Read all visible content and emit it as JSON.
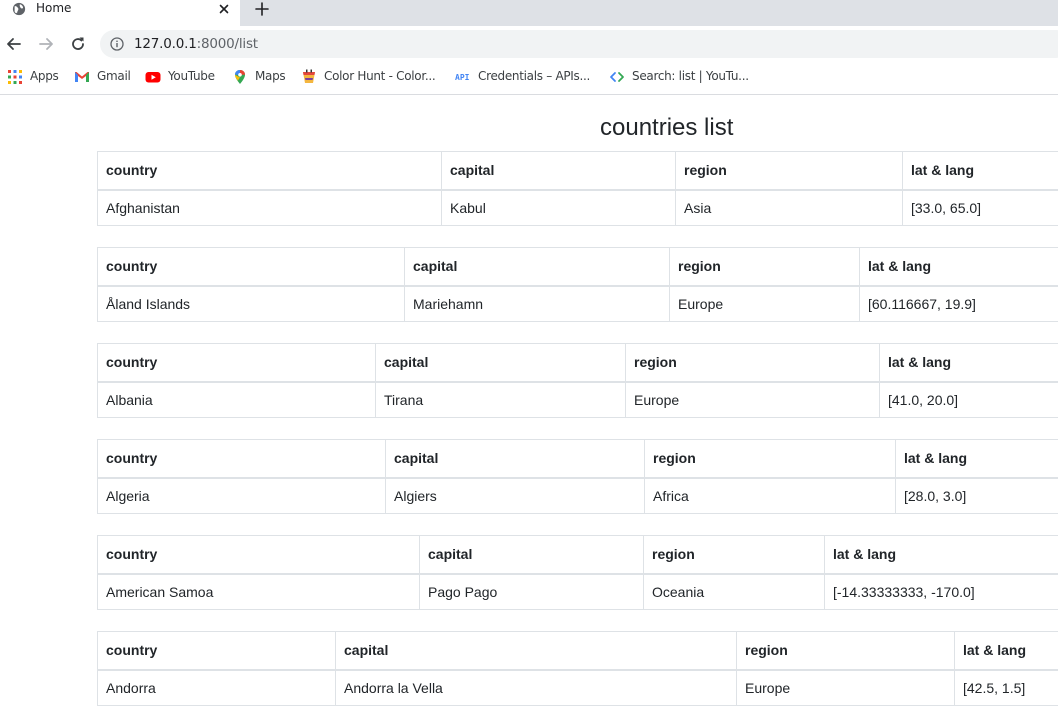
{
  "browser": {
    "tab": {
      "title": "Home"
    },
    "url": {
      "host": "127.0.0.1",
      "path": ":8000/list"
    },
    "bookmarks": [
      {
        "label": "Apps",
        "icon": "apps-grid-icon"
      },
      {
        "label": "Gmail",
        "icon": "gmail-icon"
      },
      {
        "label": "YouTube",
        "icon": "youtube-icon"
      },
      {
        "label": "Maps",
        "icon": "maps-icon"
      },
      {
        "label": "Color Hunt - Color...",
        "icon": "color-hunt-icon"
      },
      {
        "label": "Credentials – APIs...",
        "icon": "api-icon"
      },
      {
        "label": "Search: list  |  YouTu...",
        "icon": "search-code-icon"
      }
    ]
  },
  "page": {
    "title": "countries list",
    "headers": {
      "country": "country",
      "capital": "capital",
      "region": "region",
      "latlng": "lat & lang"
    },
    "countries": [
      {
        "country": "Afghanistan",
        "capital": "Kabul",
        "region": "Asia",
        "latlng": "[33.0, 65.0]"
      },
      {
        "country": "Åland Islands",
        "capital": "Mariehamn",
        "region": "Europe",
        "latlng": "[60.116667, 19.9]"
      },
      {
        "country": "Albania",
        "capital": "Tirana",
        "region": "Europe",
        "latlng": "[41.0, 20.0]"
      },
      {
        "country": "Algeria",
        "capital": "Algiers",
        "region": "Africa",
        "latlng": "[28.0, 3.0]"
      },
      {
        "country": "American Samoa",
        "capital": "Pago Pago",
        "region": "Oceania",
        "latlng": "[-14.33333333, -170.0]"
      },
      {
        "country": "Andorra",
        "capital": "Andorra la Vella",
        "region": "Europe",
        "latlng": "[42.5, 1.5]"
      }
    ]
  },
  "colors": {
    "tabstrip": "#dee1e6",
    "omnibox": "#f1f3f4",
    "border": "#dee2e6",
    "text": "#212529"
  }
}
